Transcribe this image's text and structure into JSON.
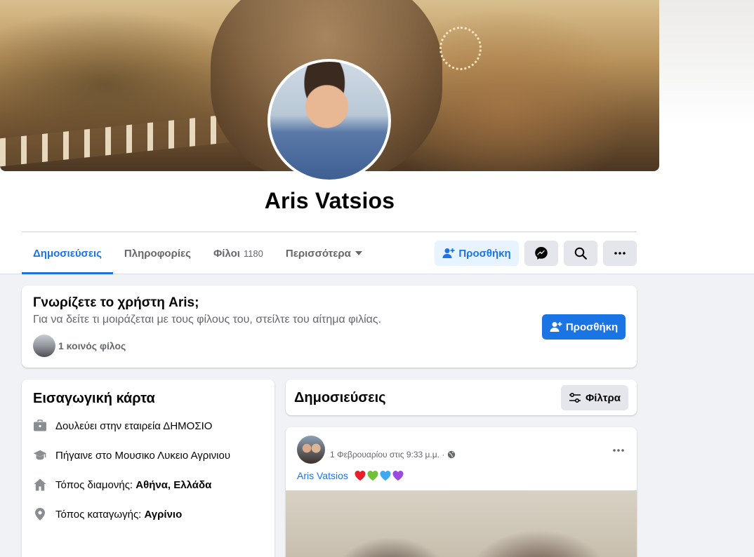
{
  "profile": {
    "name": "Aris Vatsios"
  },
  "tabs": [
    {
      "label": "Δημοσιεύσεις",
      "active": true
    },
    {
      "label": "Πληροφορίες"
    },
    {
      "label": "Φίλοι",
      "count": "1180"
    },
    {
      "label": "Περισσότερα"
    }
  ],
  "actions": {
    "add_friend_label": "Προσθήκη",
    "messenger_icon": "messenger-icon",
    "search_icon": "search-icon",
    "more_icon": "more-dots-icon"
  },
  "know_card": {
    "title": "Γνωρίζετε το χρήστη Aris;",
    "subtitle": "Για να δείτε τι μοιράζεται με τους φίλους του, στείλτε του αίτημα φιλίας.",
    "mutual": "1 κοινός φίλος",
    "add_label": "Προσθήκη"
  },
  "intro": {
    "title": "Εισαγωγική κάρτα",
    "items": [
      {
        "icon": "briefcase-icon",
        "prefix": "Δουλεύει στην εταιρεία ΔΗΜΟΣΙΟ",
        "value": ""
      },
      {
        "icon": "graduation-cap-icon",
        "prefix": "Πήγαινε στο Μουσικο Λυκειο Αγρινιου",
        "value": ""
      },
      {
        "icon": "home-icon",
        "prefix": "Τόπος διαμονής: ",
        "value": "Αθήνα, Ελλάδα"
      },
      {
        "icon": "location-pin-icon",
        "prefix": "Τόπος καταγωγής: ",
        "value": "Αγρίνιο"
      }
    ]
  },
  "posts": {
    "title": "Δημοσιεύσεις",
    "filter_label": "Φίλτρα"
  },
  "post": {
    "date": "1 Φεβρουαρίου στις 9:33 μ.μ. ·",
    "author_link": "Aris Vatsios",
    "privacy_icon": "globe-icon",
    "emojis": [
      "red-heart",
      "green-heart",
      "blue-heart",
      "purple-heart"
    ]
  },
  "colors": {
    "accent": "#1b74e4",
    "secondary_text": "#65676b",
    "page_bg": "#f0f2f5",
    "button_gray": "#e4e6eb"
  }
}
